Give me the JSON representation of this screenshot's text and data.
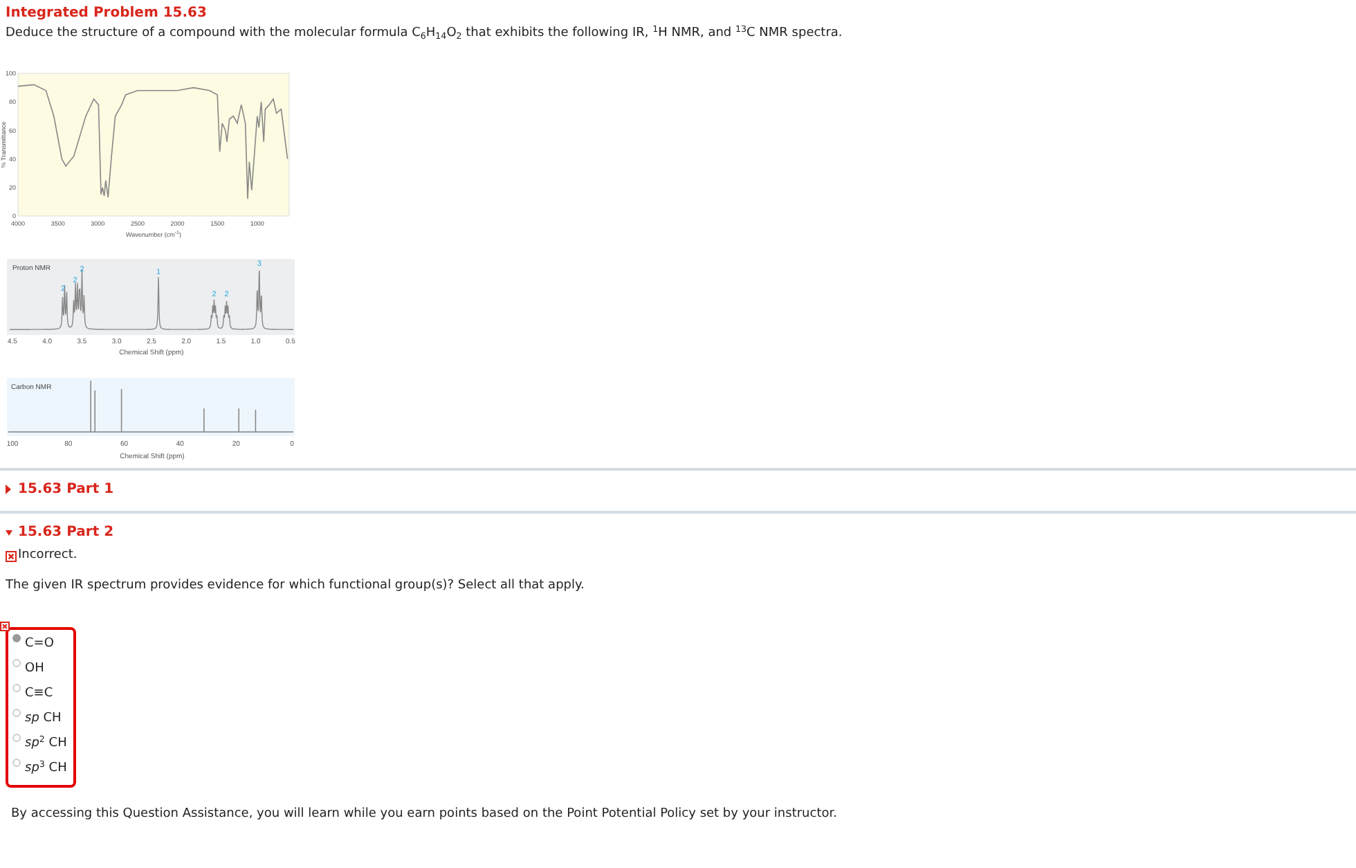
{
  "problem": {
    "title": "Integrated Problem 15.63",
    "prompt": "Deduce the structure of a compound with the molecular formula C$_{6}$H$_{14}$O$_{2}$ that exhibits the following IR, $^{1}$H NMR, and $^{13}$C NMR spectra."
  },
  "ir_spectrum": {
    "chart_data": {
      "type": "line",
      "xlabel": "Wavenumber (cm$^{-1}$)",
      "ylabel": "% Transmittance",
      "x": [
        4000,
        3800,
        3650,
        3550,
        3450,
        3400,
        3300,
        3150,
        3050,
        2990,
        2960,
        2940,
        2920,
        2900,
        2870,
        2830,
        2780,
        2700,
        2650,
        2500,
        2000,
        1800,
        1600,
        1500,
        1470,
        1440,
        1400,
        1380,
        1350,
        1300,
        1250,
        1200,
        1150,
        1120,
        1100,
        1070,
        1000,
        980,
        950,
        920,
        900,
        850,
        800,
        760,
        700,
        620
      ],
      "series": [
        {
          "color": "#888888",
          "values": [
            91,
            92,
            88,
            70,
            40,
            35,
            42,
            70,
            82,
            78,
            15,
            20,
            14,
            25,
            13,
            40,
            70,
            78,
            85,
            88,
            88,
            90,
            88,
            85,
            45,
            65,
            60,
            52,
            68,
            70,
            65,
            78,
            65,
            12,
            38,
            18,
            70,
            62,
            80,
            52,
            75,
            78,
            82,
            72,
            75,
            40
          ]
        }
      ],
      "xlim": [
        4000,
        600
      ],
      "ylim": [
        0,
        100
      ],
      "xticks": [
        4000,
        3500,
        3000,
        2500,
        2000,
        1500,
        1000
      ],
      "yticks": [
        100,
        80,
        60,
        40,
        20,
        0
      ]
    }
  },
  "proton_nmr": {
    "title": "Proton NMR",
    "peak_labels": [
      "2",
      "2",
      "2",
      "1",
      "2",
      "2",
      "3"
    ],
    "xticks": [
      "4.5",
      "4.0",
      "3.5",
      "3.0",
      "2.5",
      "2.0",
      "1.5",
      "1.0",
      "0.5"
    ],
    "xlabel": "Chemical Shift (ppm)"
  },
  "carbon_nmr": {
    "title": "Carbon NMR",
    "xticks": [
      "100",
      "80",
      "60",
      "40",
      "20",
      "0"
    ],
    "xlabel": "Chemical Shift (ppm)"
  },
  "parts": [
    {
      "title": "15.63 Part 1",
      "expanded": false
    },
    {
      "title": "15.63 Part 2",
      "expanded": true,
      "feedback": "Incorrect.",
      "question": "The given IR spectrum provides evidence for which functional group(s)? Select all that apply.",
      "incorrect": true,
      "options": [
        {
          "label": "C=O",
          "selected": true
        },
        {
          "label": "OH",
          "selected": false
        },
        {
          "label": "C≡C",
          "selected": false
        },
        {
          "label": "*sp* CH",
          "selected": false
        },
        {
          "label": "*sp*$^{2}$ CH",
          "selected": false
        },
        {
          "label": "*sp*$^{3}$ CH",
          "selected": false
        }
      ]
    }
  ],
  "footer": "By accessing this Question Assistance, you will learn while you earn points based on the Point Potential Policy set by your instructor."
}
